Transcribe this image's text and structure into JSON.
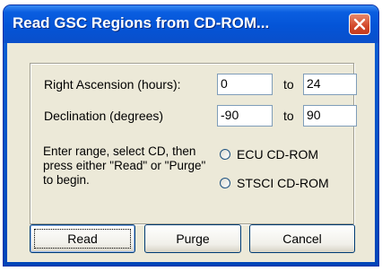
{
  "window": {
    "title": "Read GSC Regions from CD-ROM..."
  },
  "fields": {
    "ra": {
      "label": "Right Ascension (hours):",
      "from": "0",
      "to_label": "to",
      "to": "24"
    },
    "dec": {
      "label": "Declination (degrees)",
      "from": "-90",
      "to_label": "to",
      "to": "90"
    }
  },
  "instructions": "Enter range, select CD, then press either \"Read\" or \"Purge\" to begin.",
  "radios": [
    {
      "label": "ECU CD-ROM",
      "checked": false
    },
    {
      "label": "STSCI CD-ROM",
      "checked": false
    }
  ],
  "buttons": {
    "read": "Read",
    "purge": "Purge",
    "cancel": "Cancel"
  },
  "colors": {
    "titlebar": "#0454d7",
    "close": "#d3482a",
    "dialog_bg": "#ece9d8"
  }
}
